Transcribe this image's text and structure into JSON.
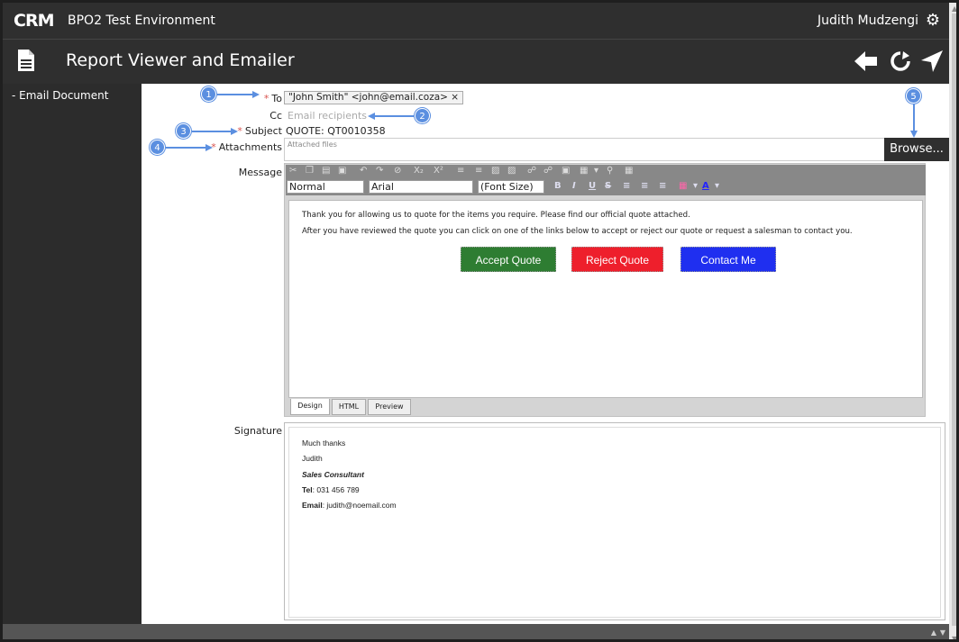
{
  "topbar": {
    "logo": "CRM",
    "env_title": "BPO2 Test Environment",
    "user_name": "Judith Mudzengi"
  },
  "header": {
    "title": "Report Viewer and Emailer"
  },
  "sidebar": {
    "items": [
      {
        "label": "- Email Document"
      }
    ]
  },
  "form": {
    "to_label": "To",
    "to_value": "\"John Smith\" <john@email.coza> ×",
    "cc_label": "Cc",
    "cc_placeholder": "Email recipients",
    "subject_label": "Subject",
    "subject_value": "QUOTE: QT0010358",
    "attachments_label": "Attachments",
    "attachments_placeholder": "Attached files",
    "browse_label": "Browse...",
    "message_label": "Message",
    "signature_label": "Signature"
  },
  "editor": {
    "format_value": "Normal",
    "font_value": "Arial",
    "font_size_value": "(Font Size)",
    "body_line1": "Thank you for allowing us to quote for the items you require. Please find our official quote attached.",
    "body_line2": "After you have reviewed the quote you can click on one of the links below to accept or reject our quote or request a salesman to contact you.",
    "buttons": [
      {
        "label": "Accept Quote",
        "color": "#2e7d32"
      },
      {
        "label": "Reject Quote",
        "color": "#ee1f2c"
      },
      {
        "label": "Contact Me",
        "color": "#1f2ff0"
      }
    ],
    "tabs": [
      "Design",
      "HTML",
      "Preview"
    ]
  },
  "signature": {
    "line1": "Much thanks",
    "line2": "Judith",
    "line3": "Sales Consultant",
    "line4_label": "Tel",
    "line4_value": ": 031 456 789",
    "line5_label": "Email",
    "line5_value": ": judith@noemail.com"
  },
  "callouts": [
    "1",
    "2",
    "3",
    "4",
    "5"
  ],
  "colors": {
    "dark_bar": "#2f2f2f",
    "callout": "#5b8fe0",
    "required": "#d9534f"
  },
  "icons": {
    "settings": "gear-icon",
    "document": "document-icon",
    "back": "arrow-left-icon",
    "refresh": "refresh-icon",
    "send": "send-icon"
  }
}
